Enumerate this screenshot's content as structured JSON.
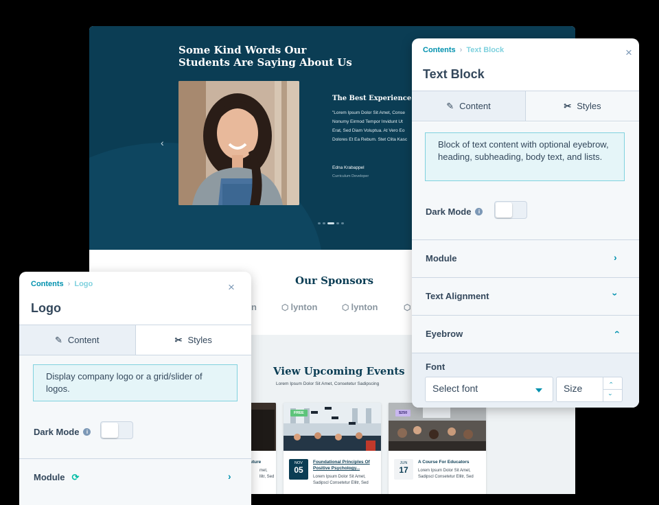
{
  "site": {
    "hero_title": "Some Kind Words Our Students Are Saying About Us",
    "quote_title": "The Best Experience...",
    "quote_lines": [
      "\"Lorem Ipsum Dolor Sit Amet, Conse",
      "Nonumy Eirmod Tempor Invidunt Ut",
      "Erat, Sed Diam Voluptua. At Vero Eo",
      "Dolores Et Ea Rebum. Stet Clita Kasc"
    ],
    "quote_name": "Edna Krabappel",
    "quote_role": "Curriculum Developer",
    "prev_arrow": "‹",
    "sponsors_title": "Our Sponsors",
    "sponsors": [
      "on",
      "lynton",
      "lynton"
    ],
    "events_title": "View Upcoming Events",
    "events_subtitle": "Lorem Ipsum Dolor Sit Amet, Consetetur Sadipscing",
    "events": [
      {
        "title": "uture",
        "desc": "met,\nllitr, Sed"
      },
      {
        "tag": "FREE",
        "month": "NOV",
        "day": "05",
        "title": "Foundational Principles Of Positive Psychology...",
        "desc": "Lorem Ipsum Dolor Sit Amet,\nSadipscl Consetetur Ellitr, Sed"
      },
      {
        "tag": "$250",
        "month": "JUN",
        "day": "17",
        "title": "A Course For Educators",
        "desc": "Lorem Ipsum Dolor Sit Amet,\nSadipscl Consetetur Ellitr, Sed"
      }
    ]
  },
  "text_block_panel": {
    "breadcrumb_root": "Contents",
    "breadcrumb_current": "Text Block",
    "title": "Text Block",
    "close": "×",
    "tab_content": "Content",
    "tab_styles": "Styles",
    "description": "Block of text content with optional eyebrow, heading, subheading, body text, and lists.",
    "dark_mode_label": "Dark Mode",
    "info_icon": "i",
    "dark_mode_on": false,
    "sections": {
      "module": "Module",
      "text_alignment": "Text Alignment",
      "eyebrow": "Eyebrow"
    },
    "font_label": "Font",
    "font_placeholder": "Select font",
    "size_placeholder": "Size"
  },
  "logo_panel": {
    "breadcrumb_root": "Contents",
    "breadcrumb_current": "Logo",
    "title": "Logo",
    "close": "×",
    "tab_content": "Content",
    "tab_styles": "Styles",
    "description": "Display company logo or a grid/slider of logos.",
    "dark_mode_label": "Dark Mode",
    "info_icon": "i",
    "dark_mode_on": false,
    "module_label": "Module"
  },
  "colors": {
    "hero_bg": "#0b3d54",
    "accent": "#0091ae",
    "panel_text": "#33475b",
    "info_bg": "#e5f5f8"
  }
}
